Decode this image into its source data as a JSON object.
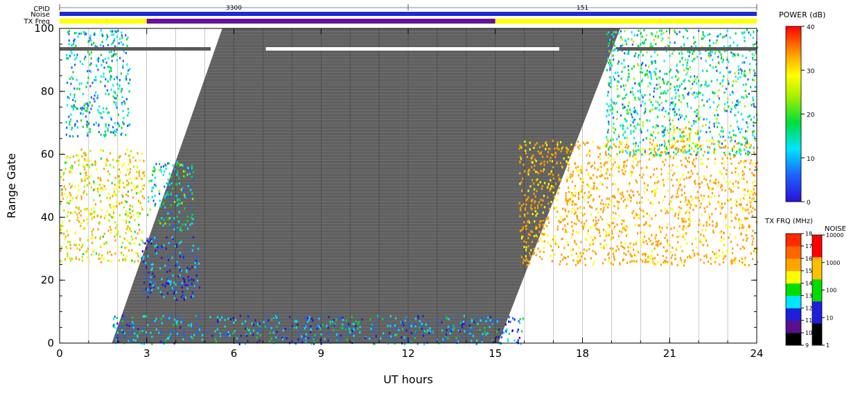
{
  "header": {
    "cpid_label": "CPID",
    "noise_label": "Noise",
    "txfreq_label": "TX Freq",
    "cpid_segments": [
      {
        "start": 0,
        "end": 12,
        "label": "3300"
      },
      {
        "start": 12,
        "end": 24,
        "label": "151"
      }
    ],
    "txfreq_segments": [
      {
        "start": 0,
        "end": 3,
        "color": "#ffff00"
      },
      {
        "start": 3,
        "end": 15,
        "color": "#6a0f9a"
      },
      {
        "start": 15,
        "end": 24,
        "color": "#ffff00"
      }
    ],
    "noise_color": "#1e2ad6"
  },
  "colorbars": {
    "power": {
      "title": "POWER (dB)",
      "ticks": [
        "0",
        "10",
        "20",
        "30",
        "40"
      ]
    },
    "txfreq": {
      "title": "TX FRQ (MHz)",
      "ticks": [
        "9",
        "10",
        "11",
        "12",
        "13",
        "14",
        "15",
        "16",
        "17",
        "18"
      ],
      "colors": [
        "#000000",
        "#5a0f8f",
        "#1e1edc",
        "#00e5ff",
        "#00dc00",
        "#ffff00",
        "#ffa500",
        "#ff6600",
        "#ff2a00"
      ]
    },
    "noise": {
      "title": "NOISE",
      "ticks": [
        "1",
        "10",
        "100",
        "1000",
        "10000"
      ],
      "colors": [
        "#000000",
        "#1e1edc",
        "#00dc00",
        "#ffc000",
        "#ff0000"
      ]
    }
  },
  "chart_data": {
    "type": "heatmap",
    "title": "",
    "xlabel": "UT hours",
    "ylabel": "Range Gate",
    "xlim": [
      0,
      24
    ],
    "ylim": [
      0,
      100
    ],
    "xticks": [
      "0",
      "3",
      "6",
      "9",
      "12",
      "15",
      "18",
      "21",
      "24"
    ],
    "yticks": [
      "0",
      "20",
      "40",
      "60",
      "80",
      "100"
    ],
    "ground_scatter_region": {
      "color": "#606060",
      "polygon_ut_gate": [
        [
          1.8,
          0
        ],
        [
          5.6,
          100
        ],
        [
          19.3,
          100
        ],
        [
          15.1,
          0
        ]
      ]
    },
    "horizontal_bars": [
      {
        "ut_start": 0,
        "ut_end": 5.2,
        "gate": 93.5,
        "color": "#5a5a5a"
      },
      {
        "ut_start": 19.2,
        "ut_end": 24,
        "gate": 93.5,
        "color": "#5a5a5a"
      },
      {
        "ut_start": 7.1,
        "ut_end": 17.2,
        "gate": 93.5,
        "color": "#ffffff"
      }
    ],
    "echo_regions": [
      {
        "name": "",
        "ut_start": 0.0,
        "ut_end": 2.9,
        "gate_low": 26,
        "gate_high": 62,
        "power_db": 32
      },
      {
        "name": "",
        "ut_start": 0.2,
        "ut_end": 2.4,
        "gate_low": 66,
        "gate_high": 100,
        "power_db": 15
      },
      {
        "name": "",
        "ut_start": 3.0,
        "ut_end": 4.6,
        "gate_low": 36,
        "gate_high": 58,
        "power_db": 17
      },
      {
        "name": "",
        "ut_start": 2.8,
        "ut_end": 4.8,
        "gate_low": 14,
        "gate_high": 34,
        "power_db": 8
      },
      {
        "name": "",
        "ut_start": 15.8,
        "ut_end": 24.0,
        "gate_low": 25,
        "gate_high": 65,
        "power_db": 38
      },
      {
        "name": "",
        "ut_start": 18.8,
        "ut_end": 24.0,
        "gate_low": 60,
        "gate_high": 100,
        "power_db": 18
      },
      {
        "name": "",
        "ut_start": 21.0,
        "ut_end": 22.0,
        "gate_low": 62,
        "gate_high": 70,
        "power_db": 35
      },
      {
        "name": "",
        "ut_start": 1.8,
        "ut_end": 16.0,
        "gate_low": 0,
        "gate_high": 9,
        "power_db": 12
      }
    ]
  }
}
